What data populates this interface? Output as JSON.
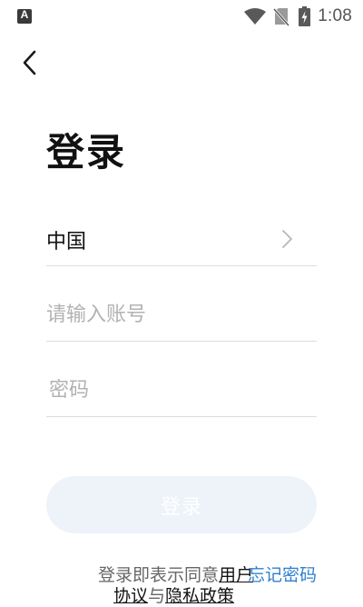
{
  "status_bar": {
    "notification_letter": "A",
    "time": "1:08",
    "icons": [
      "notification-icon",
      "wifi-icon",
      "no-sim-icon",
      "battery-charging-icon"
    ]
  },
  "header": {
    "back_icon": "chevron-left-icon"
  },
  "page": {
    "title": "登录"
  },
  "form": {
    "region_label": "中国",
    "region_icon": "chevron-right-icon",
    "account_placeholder": "请输入账号",
    "account_value": "",
    "password_placeholder": "密码",
    "password_value": "",
    "login_label": "登录"
  },
  "footer": {
    "agreement_prefix": "登录即表示同意",
    "user_agreement_visible": "用户",
    "forgot_password": "忘记密码",
    "line2_part1": "协议",
    "line2_conj": "与",
    "line2_link2": "隐私政策"
  },
  "colors": {
    "background": "#ffffff",
    "title": "#111111",
    "placeholder": "#b2b2b2",
    "divider": "#dddddd",
    "button_bg": "#edf3f9",
    "button_text": "#ffffff",
    "link_blue": "#2f7fd0",
    "muted_text": "#666666"
  }
}
